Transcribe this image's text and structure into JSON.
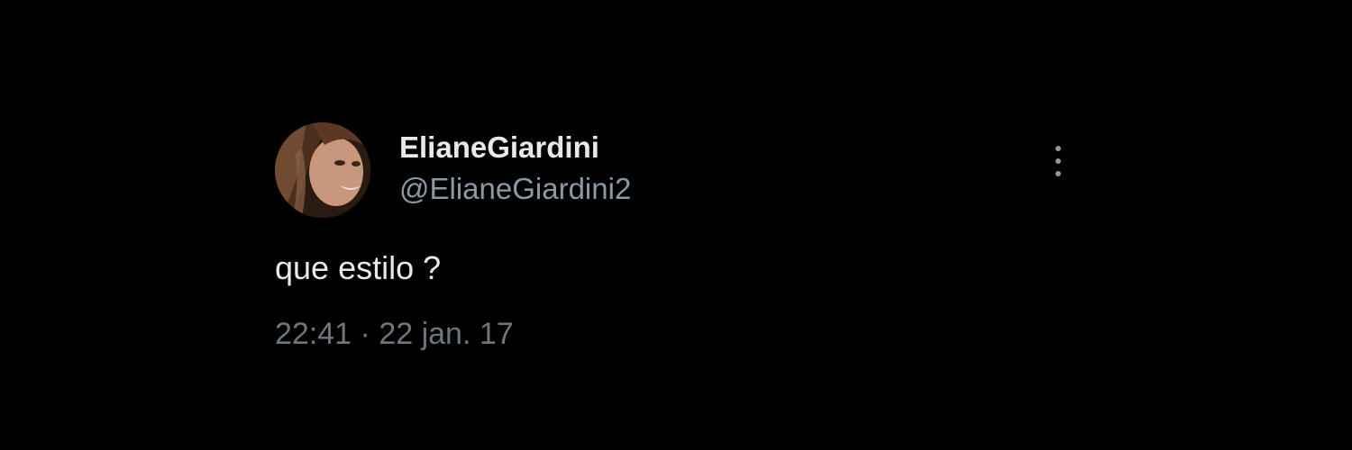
{
  "tweet": {
    "author": {
      "display_name": "ElianeGiardini",
      "handle": "@ElianeGiardini2",
      "avatar": "profile-photo"
    },
    "text": "que estilo ?",
    "time": "22:41",
    "separator": "·",
    "date": "22 jan. 17",
    "more_icon": "vertical-ellipsis-icon"
  },
  "colors": {
    "background": "#000000",
    "primary_text": "#e7e9ea",
    "secondary_text": "#8b98a5",
    "timestamp_text": "#6e767d"
  }
}
